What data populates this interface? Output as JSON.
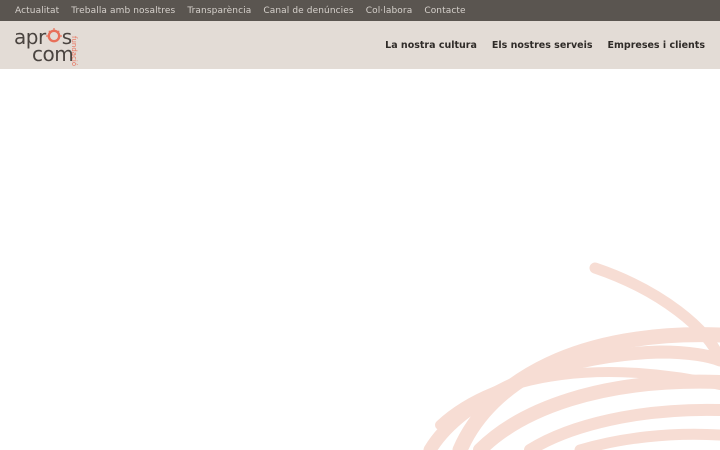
{
  "topbar": {
    "links": [
      "Actualitat",
      "Treballa amb nosaltres",
      "Transparència",
      "Canal de denúncies",
      "Col·labora",
      "Contacte"
    ]
  },
  "logo": {
    "line1": "apr",
    "line1_end": "s",
    "line2": "com",
    "vertical": "fundació"
  },
  "nav": {
    "items": [
      "La nostra cultura",
      "Els nostres serveis",
      "Empreses i clients"
    ]
  },
  "colors": {
    "topbar_bg": "#5a5550",
    "header_bg": "#e3dcd6",
    "accent": "#e8705a",
    "decor": "#f7ddd4"
  }
}
